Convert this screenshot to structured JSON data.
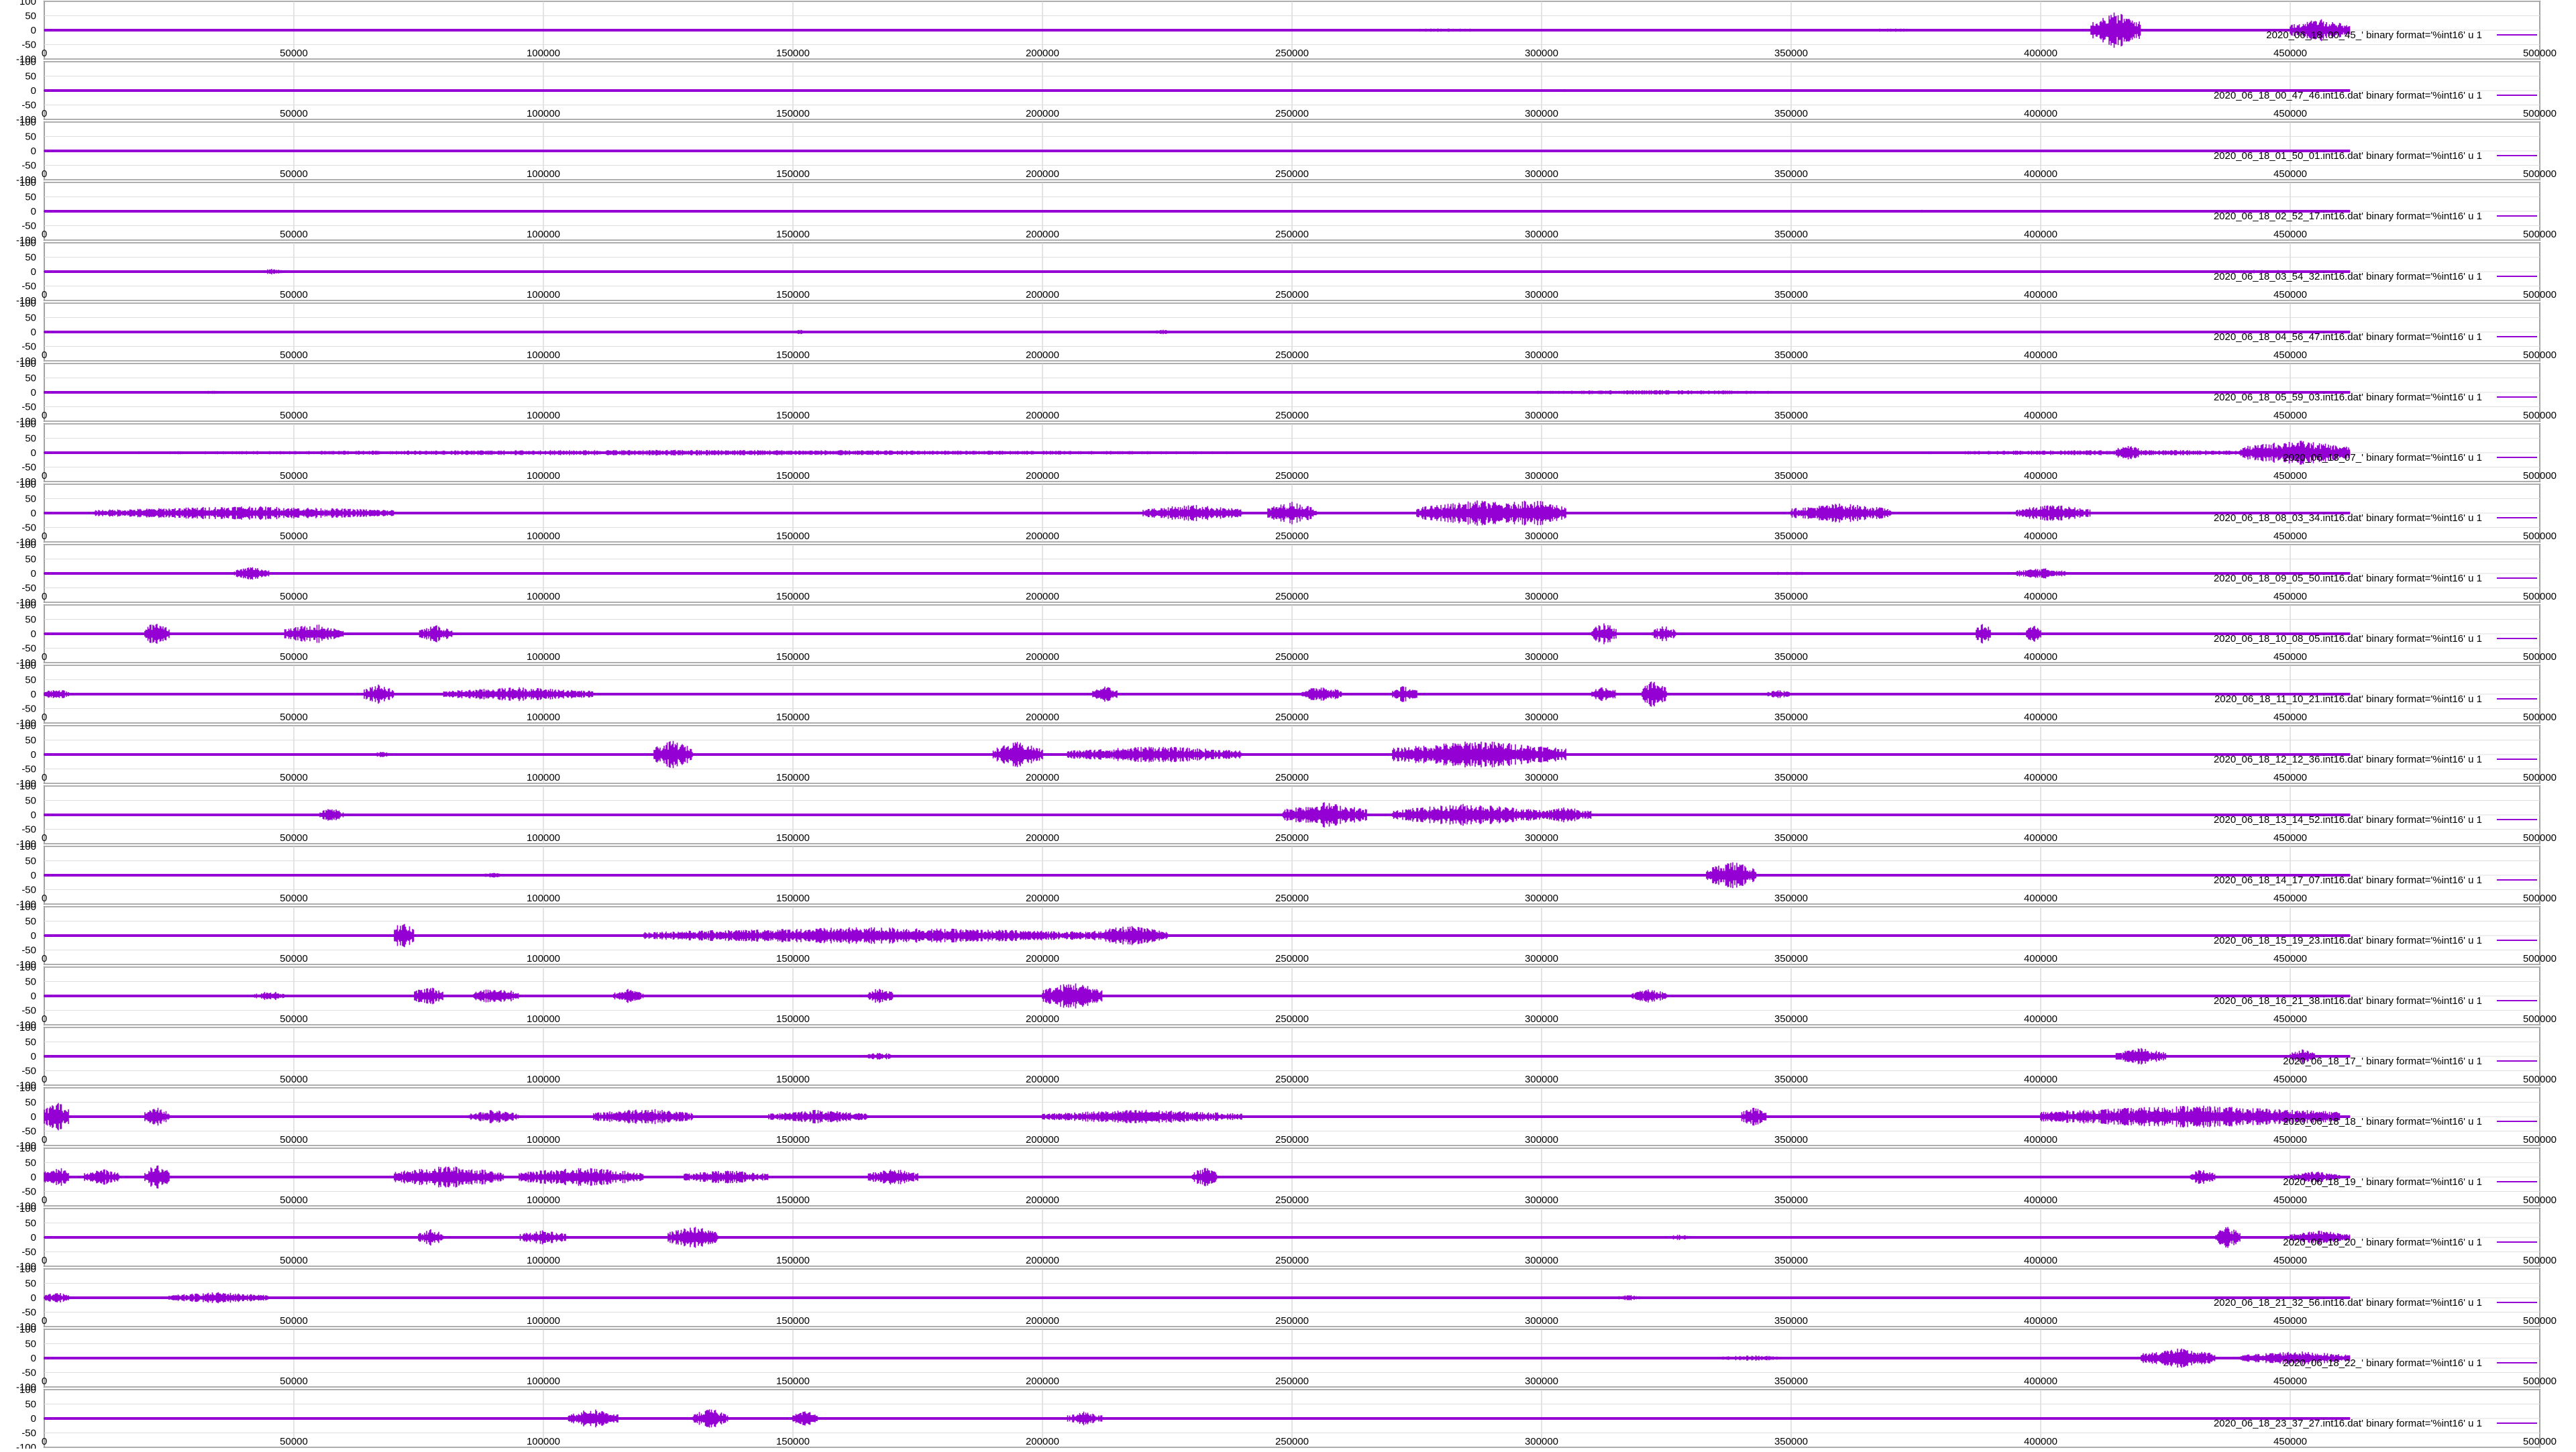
{
  "chart_data": {
    "type": "line",
    "layout": "stacked-panels",
    "xlim": [
      0,
      500000
    ],
    "ylim": [
      -100,
      100
    ],
    "xticks": [
      0,
      50000,
      100000,
      150000,
      200000,
      250000,
      300000,
      350000,
      400000,
      450000,
      500000
    ],
    "yticks": [
      -100,
      -50,
      0,
      50,
      100
    ],
    "grid": true,
    "legend_position": "right",
    "series_color": "#9400d3",
    "sample_count": 462000,
    "panels": [
      {
        "legend": "2020_06_18_00_45_",
        "suffix": "' binary format='%int16' u 1",
        "bursts": [
          [
            410000,
            420000,
            65
          ],
          [
            450000,
            462000,
            40
          ],
          [
            260000,
            300000,
            6
          ],
          [
            360000,
            380000,
            6
          ]
        ]
      },
      {
        "legend": "2020_06_18_00_47_46.int16.dat",
        "suffix": "' binary format='%int16' u 1",
        "bursts": [
          [
            270000,
            340000,
            5
          ]
        ]
      },
      {
        "legend": "2020_06_18_01_50_01.int16.dat",
        "suffix": "' binary format='%int16' u 1",
        "bursts": [
          [
            290000,
            350000,
            5
          ]
        ]
      },
      {
        "legend": "2020_06_18_02_52_17.int16.dat",
        "suffix": "' binary format='%int16' u 1",
        "bursts": [
          [
            345000,
            405000,
            5
          ]
        ]
      },
      {
        "legend": "2020_06_18_03_54_32.int16.dat",
        "suffix": "' binary format='%int16' u 1",
        "bursts": [
          [
            43000,
            48000,
            10
          ],
          [
            425000,
            462000,
            6
          ]
        ]
      },
      {
        "legend": "2020_06_18_04_56_47.int16.dat",
        "suffix": "' binary format='%int16' u 1",
        "bursts": [
          [
            150000,
            153000,
            8
          ],
          [
            222000,
            226000,
            10
          ]
        ]
      },
      {
        "legend": "2020_06_18_05_59_03.int16.dat",
        "suffix": "' binary format='%int16' u 1",
        "bursts": [
          [
            285000,
            360000,
            8
          ],
          [
            32000,
            35000,
            8
          ]
        ]
      },
      {
        "legend": "2020_06_18_07_",
        "suffix": "' binary format='%int16' u 1",
        "bursts": [
          [
            10000,
            245000,
            10
          ],
          [
            375000,
            462000,
            10
          ],
          [
            415000,
            420000,
            30
          ],
          [
            440000,
            462000,
            45
          ]
        ]
      },
      {
        "legend": "2020_06_18_08_03_34.int16.dat",
        "suffix": "' binary format='%int16' u 1",
        "bursts": [
          [
            10000,
            70000,
            25
          ],
          [
            220000,
            240000,
            30
          ],
          [
            245000,
            255000,
            40
          ],
          [
            275000,
            300000,
            45
          ],
          [
            290000,
            305000,
            50
          ],
          [
            350000,
            370000,
            35
          ],
          [
            395000,
            410000,
            30
          ]
        ]
      },
      {
        "legend": "2020_06_18_09_05_50.int16.dat",
        "suffix": "' binary format='%int16' u 1",
        "bursts": [
          [
            38000,
            45000,
            25
          ],
          [
            395000,
            405000,
            20
          ],
          [
            340000,
            360000,
            6
          ]
        ]
      },
      {
        "legend": "2020_06_18_10_08_05.int16.dat",
        "suffix": "' binary format='%int16' u 1",
        "bursts": [
          [
            20000,
            25000,
            45
          ],
          [
            48000,
            60000,
            35
          ],
          [
            75000,
            82000,
            30
          ],
          [
            310000,
            315000,
            40
          ],
          [
            322000,
            327000,
            30
          ],
          [
            387000,
            390000,
            40
          ],
          [
            397000,
            400000,
            35
          ]
        ]
      },
      {
        "legend": "2020_06_18_11_10_21.int16.dat",
        "suffix": "' binary format='%int16' u 1",
        "bursts": [
          [
            0,
            5000,
            20
          ],
          [
            64000,
            70000,
            35
          ],
          [
            80000,
            110000,
            25
          ],
          [
            210000,
            215000,
            30
          ],
          [
            252000,
            260000,
            30
          ],
          [
            270000,
            275000,
            30
          ],
          [
            310000,
            315000,
            30
          ],
          [
            320000,
            325000,
            50
          ],
          [
            345000,
            350000,
            15
          ]
        ]
      },
      {
        "legend": "2020_06_18_12_12_36.int16.dat",
        "suffix": "' binary format='%int16' u 1",
        "bursts": [
          [
            122000,
            130000,
            50
          ],
          [
            190000,
            200000,
            45
          ],
          [
            205000,
            240000,
            30
          ],
          [
            270000,
            305000,
            50
          ],
          [
            65000,
            70000,
            10
          ]
        ]
      },
      {
        "legend": "2020_06_18_13_14_52.int16.dat",
        "suffix": "' binary format='%int16' u 1",
        "bursts": [
          [
            55000,
            60000,
            25
          ],
          [
            248000,
            265000,
            45
          ],
          [
            270000,
            300000,
            40
          ],
          [
            300000,
            310000,
            30
          ]
        ]
      },
      {
        "legend": "2020_06_18_14_17_07.int16.dat",
        "suffix": "' binary format='%int16' u 1",
        "bursts": [
          [
            333000,
            343000,
            50
          ],
          [
            88000,
            92000,
            10
          ]
        ]
      },
      {
        "legend": "2020_06_18_15_19_23.int16.dat",
        "suffix": "' binary format='%int16' u 1",
        "bursts": [
          [
            70000,
            74000,
            55
          ],
          [
            120000,
            210000,
            30
          ],
          [
            210000,
            225000,
            35
          ]
        ]
      },
      {
        "legend": "2020_06_18_16_21_38.int16.dat",
        "suffix": "' binary format='%int16' u 1",
        "bursts": [
          [
            42000,
            48000,
            20
          ],
          [
            74000,
            80000,
            35
          ],
          [
            86000,
            95000,
            30
          ],
          [
            114000,
            120000,
            25
          ],
          [
            165000,
            170000,
            30
          ],
          [
            200000,
            212000,
            50
          ],
          [
            318000,
            325000,
            25
          ]
        ]
      },
      {
        "legend": "2020_06_18_17_",
        "suffix": "' binary format='%int16' u 1",
        "bursts": [
          [
            415000,
            425000,
            30
          ],
          [
            450000,
            455000,
            25
          ],
          [
            165000,
            170000,
            15
          ]
        ]
      },
      {
        "legend": "2020_06_18_18_",
        "suffix": "' binary format='%int16' u 1",
        "bursts": [
          [
            0,
            5000,
            55
          ],
          [
            20000,
            25000,
            35
          ],
          [
            85000,
            95000,
            25
          ],
          [
            110000,
            130000,
            30
          ],
          [
            145000,
            165000,
            25
          ],
          [
            200000,
            240000,
            25
          ],
          [
            340000,
            345000,
            35
          ],
          [
            400000,
            460000,
            40
          ]
        ]
      },
      {
        "legend": "2020_06_18_19_",
        "suffix": "' binary format='%int16' u 1",
        "bursts": [
          [
            0,
            5000,
            40
          ],
          [
            8000,
            15000,
            30
          ],
          [
            20000,
            25000,
            45
          ],
          [
            70000,
            92000,
            40
          ],
          [
            95000,
            120000,
            35
          ],
          [
            128000,
            145000,
            25
          ],
          [
            165000,
            175000,
            30
          ],
          [
            230000,
            235000,
            35
          ],
          [
            430000,
            435000,
            30
          ],
          [
            450000,
            460000,
            20
          ]
        ]
      },
      {
        "legend": "2020_06_18_20_",
        "suffix": "' binary format='%int16' u 1",
        "bursts": [
          [
            75000,
            80000,
            30
          ],
          [
            95000,
            105000,
            25
          ],
          [
            125000,
            135000,
            40
          ],
          [
            435000,
            440000,
            40
          ],
          [
            450000,
            462000,
            25
          ],
          [
            325000,
            330000,
            10
          ]
        ]
      },
      {
        "legend": "2020_06_18_21_32_56.int16.dat",
        "suffix": "' binary format='%int16' u 1",
        "bursts": [
          [
            0,
            5000,
            20
          ],
          [
            25000,
            45000,
            20
          ],
          [
            315000,
            320000,
            10
          ]
        ]
      },
      {
        "legend": "2020_06_18_22_",
        "suffix": "' binary format='%int16' u 1",
        "bursts": [
          [
            420000,
            435000,
            35
          ],
          [
            440000,
            462000,
            25
          ],
          [
            335000,
            350000,
            10
          ]
        ]
      },
      {
        "legend": "2020_06_18_23_37_27.int16.dat",
        "suffix": "' binary format='%int16' u 1",
        "bursts": [
          [
            105000,
            115000,
            35
          ],
          [
            130000,
            137000,
            35
          ],
          [
            150000,
            155000,
            30
          ],
          [
            205000,
            212000,
            25
          ]
        ]
      }
    ]
  }
}
